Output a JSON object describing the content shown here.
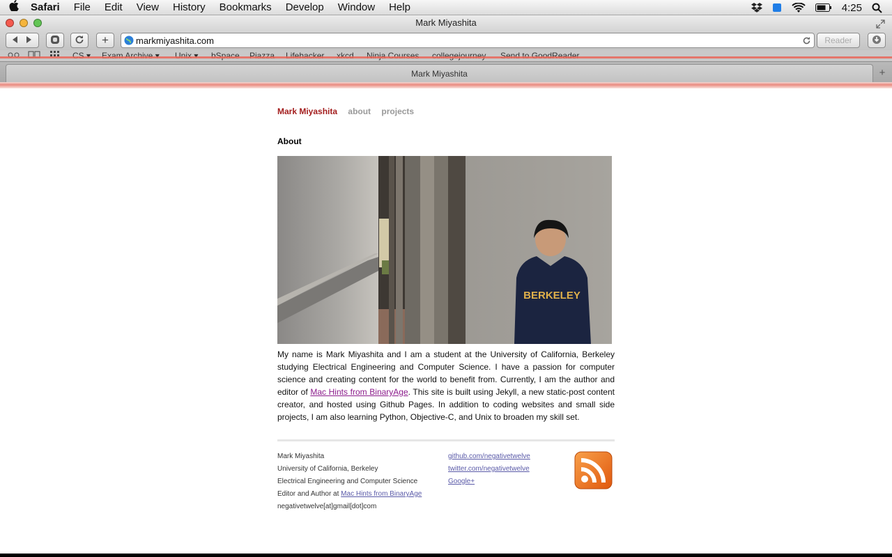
{
  "menubar": {
    "app": "Safari",
    "items": [
      "File",
      "Edit",
      "View",
      "History",
      "Bookmarks",
      "Develop",
      "Window",
      "Help"
    ],
    "time": "4:25"
  },
  "window": {
    "title": "Mark Miyashita",
    "url": "markmiyashita.com",
    "reader_label": "Reader"
  },
  "bookmarks": [
    "CS",
    "Exam Archive",
    "Unix",
    "bSpace",
    "Piazza",
    "Lifehacker",
    "xkcd",
    "Ninja Courses",
    "collegejourney",
    "Send to GoodReader"
  ],
  "tab": {
    "title": "Mark Miyashita"
  },
  "site": {
    "brand": "Mark Miyashita",
    "nav": [
      "about",
      "projects"
    ],
    "section_title": "About",
    "bio_before": "My name is Mark Miyashita and I am a student at the University of California, Berkeley studying Electrical Engineering and Computer Science. I have a passion for computer science and creating content for the world to benefit from. Currently, I am the author and editor of ",
    "bio_link": "Mac Hints from BinaryAge",
    "bio_after": ". This site is built using Jekyll, a new static-post content creator, and hosted using Github Pages. In addition to coding websites and small side projects, I am also learning Python, Objective-C, and Unix to broaden my skill set.",
    "footer": {
      "name": "Mark Miyashita",
      "school": "University of California, Berkeley",
      "major": "Electrical Engineering and Computer Science",
      "editor_prefix": "Editor and Author at ",
      "editor_link": "Mac Hints from BinaryAge",
      "email": "negativetwelve[at]gmail[dot]com",
      "links": [
        "github.com/negativetwelve",
        "twitter.com/negativetwelve",
        "Google+"
      ]
    },
    "sweatshirt_text": "BERKELEY"
  },
  "colors": {
    "brand_red": "#a31d1d",
    "link_purple": "#8b1b8b",
    "footer_link": "#5a5aa8",
    "rss_orange": "#f07a1f"
  }
}
